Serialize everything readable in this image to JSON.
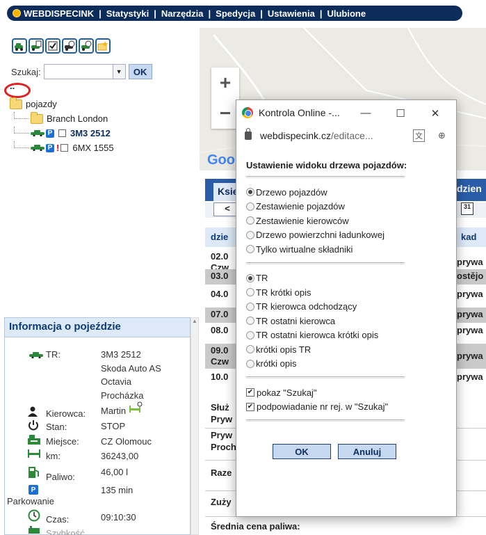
{
  "nav": {
    "items": [
      "WEBDISPECINK",
      "Statystyki",
      "Narzędzia",
      "Spedycja",
      "Ustawienia",
      "Ulubione"
    ],
    "separator": "|"
  },
  "search": {
    "label": "Szukaj:",
    "value": "",
    "button": "OK"
  },
  "tree": {
    "root_dots": "..",
    "root": "pojazdy",
    "branch": "Branch London",
    "vehicles": [
      {
        "plate": "3M3 2512",
        "bold": true,
        "badge": "P",
        "alert": ""
      },
      {
        "plate": "6MX 1555",
        "bold": false,
        "badge": "P",
        "alert": "!"
      }
    ]
  },
  "info": {
    "title": "Informacja o pojeździe",
    "tr_label": "TR:",
    "tr_lines": [
      "3M3 2512",
      "Skoda Auto AS",
      "Octavia",
      "Procházka"
    ],
    "driver_label": "Kierowca:",
    "driver_value": "Martin",
    "stan_label": "Stan:",
    "stan_value": "STOP",
    "place_label": "Miejsce:",
    "place_value": "CZ Olomouc",
    "km_label": "km:",
    "km_value": "36243,00",
    "fuel_label": "Paliwo:",
    "fuel_value": "46,00 l",
    "parking_label": "Parkowanie",
    "parking_badge": "P",
    "parking_value": "135 min",
    "time_label": "Czas:",
    "time_value": "09:10:30",
    "speed_label": "Szybkość"
  },
  "map": {
    "zoom_in": "+",
    "zoom_out": "−",
    "google_partial": "Goo"
  },
  "behind": {
    "tab": "Ksie",
    "tab_right": "dzien",
    "nav_prev": "<",
    "cal_day": "31",
    "head_left": "dzie",
    "head_right": "kad",
    "rows": [
      {
        "left": "02.0",
        "left2": "Czw",
        "right": "prywa",
        "gray": false
      },
      {
        "left": "03.0",
        "left2": "",
        "right": "ostějo",
        "gray": true
      },
      {
        "left": "04.0",
        "left2": "",
        "right": "prywa",
        "gray": false
      },
      {
        "left": "07.0",
        "left2": "",
        "right": "prywa",
        "gray": true
      },
      {
        "left": "08.0",
        "left2": "",
        "right": "prywa",
        "gray": false
      },
      {
        "left": "09.0",
        "left2": "Czw",
        "right": "prywa",
        "gray": true
      },
      {
        "left": "10.0",
        "left2": "",
        "right": "prywa",
        "gray": false
      }
    ],
    "sluz": [
      "Służ",
      "Pryw"
    ],
    "pryw": [
      "Pryw",
      "Proch"
    ],
    "raze": "Raze",
    "zuzy": "Zuży",
    "avg_fuel": "Średnia cena paliwa:"
  },
  "dialog": {
    "title": "Kontrola Online -...",
    "url_host": "webdispecink.cz",
    "url_path": "/editace...",
    "heading": "Ustawienie widoku drzewa pojazdów:",
    "group1": [
      {
        "label": "Drzewo pojazdów",
        "selected": true
      },
      {
        "label": "Zestawienie pojazdów",
        "selected": false
      },
      {
        "label": "Zestawienie kierowców",
        "selected": false
      },
      {
        "label": "Drzewo powierzchni ładunkowej",
        "selected": false
      },
      {
        "label": "Tylko wirtualne składniki",
        "selected": false
      }
    ],
    "group2": [
      {
        "label": "TR",
        "selected": true
      },
      {
        "label": "TR krótki opis",
        "selected": false
      },
      {
        "label": "TR kierowca odchodzący",
        "selected": false
      },
      {
        "label": "TR ostatni kierowca",
        "selected": false
      },
      {
        "label": "TR ostatni kierowca krótki opis",
        "selected": false
      },
      {
        "label": "krótki opis TR",
        "selected": false
      },
      {
        "label": "krótki opis",
        "selected": false
      }
    ],
    "checks": [
      {
        "label": "pokaz \"Szukaj\"",
        "checked": true
      },
      {
        "label": "podpowiadanie nr rej. w \"Szukaj\"",
        "checked": true
      }
    ],
    "ok": "OK",
    "cancel": "Anuluj"
  }
}
